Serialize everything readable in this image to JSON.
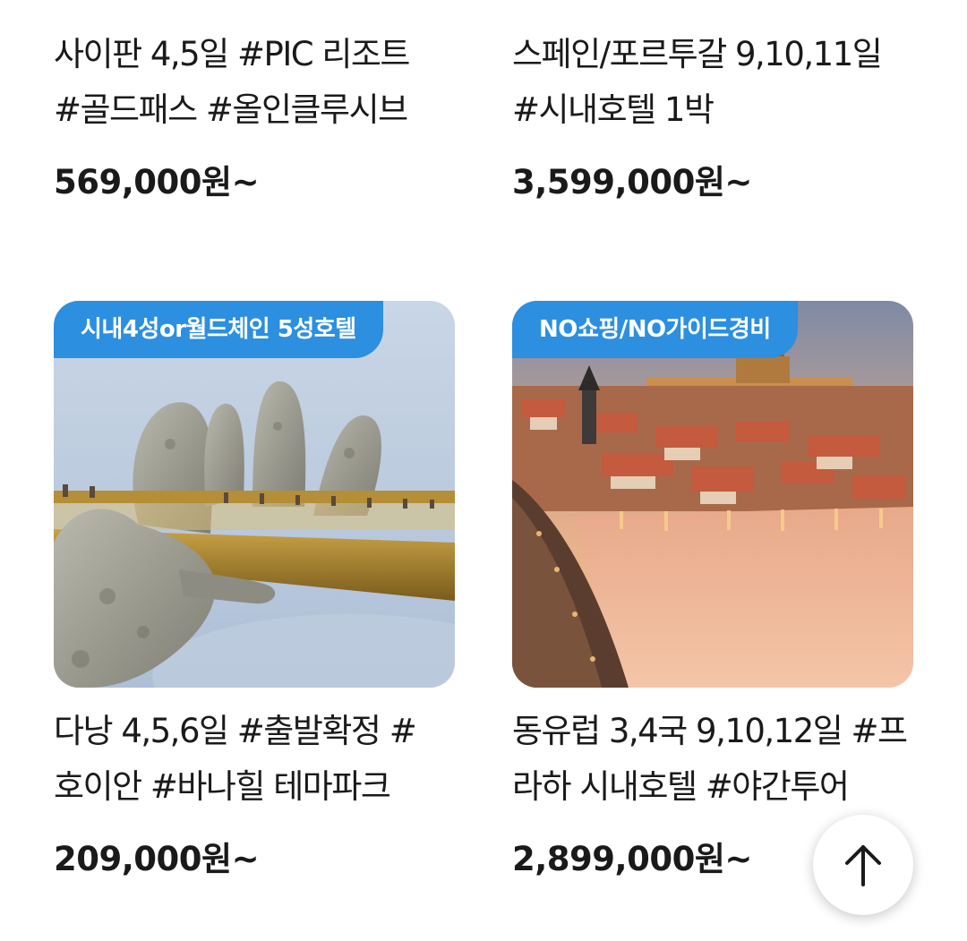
{
  "products": [
    {
      "title_line1": "사이판 4,5일 #PIC 리조트",
      "title_line2": "#골드패스 #올인클루시브",
      "price": "569,000원~"
    },
    {
      "title_line1": "스페인/포르투갈 9,10,11일",
      "title_line2": "#시내호텔 1박",
      "price": "3,599,000원~"
    },
    {
      "badge": "시내4성or월드체인 5성호텔",
      "image_icon": "golden-bridge-hands-photo",
      "title_line1": "다낭 4,5,6일 #출발확정 #",
      "title_line2": "호이안 #바나힐 테마파크",
      "price": "209,000원~"
    },
    {
      "badge": "NO쇼핑/NO가이드경비",
      "image_icon": "prague-river-city-photo",
      "title_line1": "동유럽 3,4국 9,10,12일 #프",
      "title_line2": "라하 시내호텔 #야간투어",
      "price": "2,899,000원~"
    }
  ],
  "scroll_top_icon": "arrow-up-icon",
  "colors": {
    "badge": "#2c8fe0",
    "text": "#1a1a1a",
    "background": "#ffffff"
  }
}
